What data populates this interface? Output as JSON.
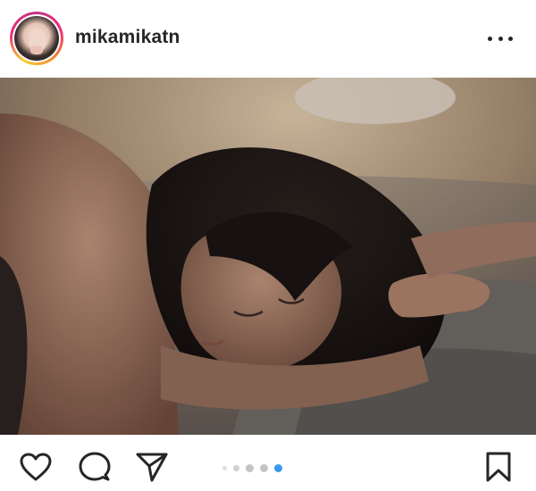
{
  "post": {
    "username": "mikamikatn",
    "avatar_icon": "profile-avatar",
    "more_icon": "more-horizontal-icon",
    "image": {
      "subject": "photo",
      "carousel_total": 5,
      "carousel_active_index": 5
    },
    "actions": {
      "like_icon": "heart-icon",
      "comment_icon": "comment-bubble-icon",
      "share_icon": "paper-plane-icon",
      "save_icon": "bookmark-icon"
    },
    "colors": {
      "text": "#262626",
      "active_dot": "#3897f0",
      "inactive_dot": "#c4c4c4",
      "story_ring_start": "#f9ce34",
      "story_ring_mid": "#ee2a7b",
      "story_ring_end": "#6228d7"
    }
  }
}
